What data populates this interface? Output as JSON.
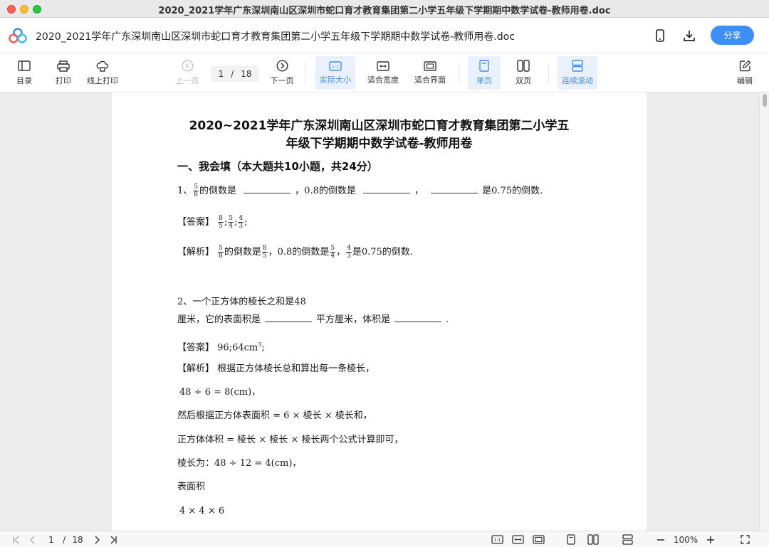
{
  "window": {
    "title": "2020_2021学年广东深圳南山区深圳市蛇口育才教育集团第二小学五年级下学期期中数学试卷-教师用卷.doc"
  },
  "header": {
    "doc_title": "2020_2021学年广东深圳南山区深圳市蛇口育才教育集团第二小学五年级下学期期中数学试卷-教师用卷.doc",
    "share_label": "分享",
    "icons": [
      "app-logo-icon",
      "phone-icon",
      "download-icon"
    ]
  },
  "toolbar": {
    "toc": "目录",
    "print": "打印",
    "online_print": "线上打印",
    "prev_page": "上一页",
    "current_page": "1",
    "page_sep": "/",
    "total_pages": "18",
    "next_page": "下一页",
    "actual_size": "实际大小",
    "fit_width": "适合宽度",
    "fit_window": "适合界面",
    "single_page": "单页",
    "double_page": "双页",
    "continuous_scroll": "连续滚动",
    "edit": "编辑",
    "actual_size_icon_text": "1:1"
  },
  "document": {
    "title_line1": "2020~2021学年广东深圳南山区深圳市蛇口育才教育集团第二小学五",
    "title_line2": "年级下学期期中数学试卷-教师用卷",
    "section1": "一、我会填（本大题共10小题，共24分）",
    "q1": {
      "prefix": "1、",
      "f1_num": "5",
      "f1_den": "8",
      "t1": "的倒数是",
      "t2": "，0.8的倒数是",
      "t3": "，",
      "t4": "是0.75的倒数."
    },
    "a1": {
      "label": "【答案】",
      "f1_num": "8",
      "f1_den": "5",
      "f2_num": "5",
      "f2_den": "4",
      "f3_num": "4",
      "f3_den": "3",
      "sep": ";",
      "end": ";"
    },
    "e1": {
      "label": "【解析】",
      "f1_num": "5",
      "f1_den": "8",
      "t1": "的倒数是",
      "f2_num": "8",
      "f2_den": "5",
      "t2": "，0.8的倒数是",
      "f3_num": "5",
      "f3_den": "4",
      "t3": "，",
      "f4_num": "4",
      "f4_den": "3",
      "t4": "是0.75的倒数."
    },
    "q2_line1": "2、一个正方体的棱长之和是48",
    "q2_line2_a": "厘米，它的表面积是",
    "q2_line2_b": "平方厘米，体积是",
    "q2_line2_c": ".",
    "a2_label": "【答案】",
    "a2_text": "96;64cm",
    "a2_sup": "3",
    "a2_end": ";",
    "e2_label": "【解析】",
    "e2_text": "根据正方体棱长总和算出每一条棱长，",
    "l1": "48 ÷ 6 = 8(cm)，",
    "l2": "然后根据正方体表面积 = 6 × 棱长 × 棱长和，",
    "l3": "正方体体积 = 棱长 × 棱长 × 棱长两个公式计算即可，",
    "l4": "棱长为：48 ÷ 12 = 4(cm)，",
    "l5": "表面积",
    "l6": "4 × 4 × 6"
  },
  "statusbar": {
    "current_page": "1",
    "page_sep": "/",
    "total_pages": "18",
    "zoom": "100%",
    "actual_size_icon_text": "1:1"
  },
  "colors": {
    "accent": "#3d8ef7",
    "active_bg": "#e8f1fd"
  }
}
